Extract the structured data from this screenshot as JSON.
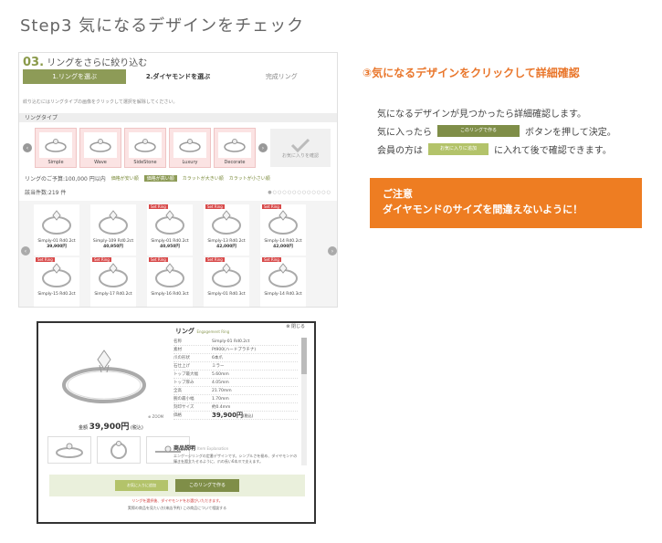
{
  "step_title": "Step3 気になるデザインをチェック",
  "screenshot": {
    "number": "03.",
    "heading": "リングをさらに絞り込む",
    "steps": [
      "1.リングを選ぶ",
      "2.ダイヤモンドを選ぶ",
      "完成リング"
    ],
    "instruction": "絞り込むにはリングタイプの画像をクリックして選択を解除してください。",
    "type_label": "リングタイプ",
    "types": [
      "Simple",
      "Wave",
      "SideStone",
      "Luxury",
      "Decorate"
    ],
    "check_label": "お気に入りを確認",
    "budget": "リングのご予算:100,000 円以内",
    "sorts": [
      "価格が安い順",
      "価格が高い順",
      "カラットが大きい順",
      "カラットが小さい順"
    ],
    "count": "該当件数:219 件",
    "rings": [
      {
        "name": "Simply-01 Rd0.2ct",
        "price": "39,900円",
        "tag": ""
      },
      {
        "name": "Simply-109 Rd0.2ct",
        "price": "40,950円",
        "tag": ""
      },
      {
        "name": "Simply-01 Rd0.2ct",
        "price": "40,950円",
        "tag": "Set Ring"
      },
      {
        "name": "Simply-13 Rd0.2ct",
        "price": "42,000円",
        "tag": "Set Ring"
      },
      {
        "name": "Simply-14 Rd0.2ct",
        "price": "42,000円",
        "tag": "Set Ring"
      },
      {
        "name": "Simply-15 Rd0.2ct",
        "price": "",
        "tag": "Set Ring"
      },
      {
        "name": "Simply-17 Rd0.2ct",
        "price": "",
        "tag": "Set Ring"
      },
      {
        "name": "Simply-16 Rd0.3ct",
        "price": "",
        "tag": "Set Ring"
      },
      {
        "name": "Simply-01 Rd0.3ct",
        "price": "",
        "tag": "Set Ring"
      },
      {
        "name": "Simply-14 Rd0.3ct",
        "price": "",
        "tag": "Set Ring"
      }
    ]
  },
  "explanation": {
    "heading": "③気になるデザインをクリックして詳細確認",
    "line1": "気になるデザインが見つかったら詳細確認します。",
    "line2_pre": "気に入ったら",
    "line2_btn": "このリングで作る",
    "line2_post": "ボタンを押して決定。",
    "line3_pre": "会員の方は",
    "line3_btn": "お気に入りに追加",
    "line3_post": "に入れて後で確認できます。",
    "notice_1": "ご注意",
    "notice_2": "ダイヤモンドのサイズを間違えないように！"
  },
  "modal": {
    "close": "閉じる",
    "title": "リング",
    "title_sub": "Engagement Ring",
    "price_label": "金額",
    "price": "39,900円",
    "price_tax": "(税込)",
    "zoom": "ZOOM",
    "specs": [
      {
        "k": "名称",
        "v": "Simply-01 Rd0.2ct"
      },
      {
        "k": "素材",
        "v": "Pt900(ハードプラチナ)"
      },
      {
        "k": "爪の形状",
        "v": "6本爪"
      },
      {
        "k": "石仕上げ",
        "v": "ミラー"
      },
      {
        "k": "トップ最大幅",
        "v": "5.60mm"
      },
      {
        "k": "トップ厚み",
        "v": "4.05mm"
      },
      {
        "k": "全高",
        "v": "21.70mm"
      },
      {
        "k": "腕の最小幅",
        "v": "1.70mm"
      },
      {
        "k": "刻印サイズ",
        "v": "約0.4mm"
      }
    ],
    "price_row_label": "価格",
    "price_row_value": "39,900円",
    "desc_title": "商品説明",
    "desc_sub": "Item Explanation",
    "desc": "エンゲージリングの定番デザインです。シンプルさを極め、ダイヤモンドの輝きを際立たせるように、爪の長い6本爪で支えます。",
    "fav_btn": "お気に入りに追加",
    "select_btn": "このリングで作る",
    "note": "リングを選択後、ダイヤモンドをお選びいただきます。",
    "links": "実際の商品を見たい方(来店予約)  この商品について相談する"
  },
  "colors": {
    "accent_orange": "#ee7d22",
    "olive": "#8d9b57",
    "pink": "#fbe3e3"
  }
}
